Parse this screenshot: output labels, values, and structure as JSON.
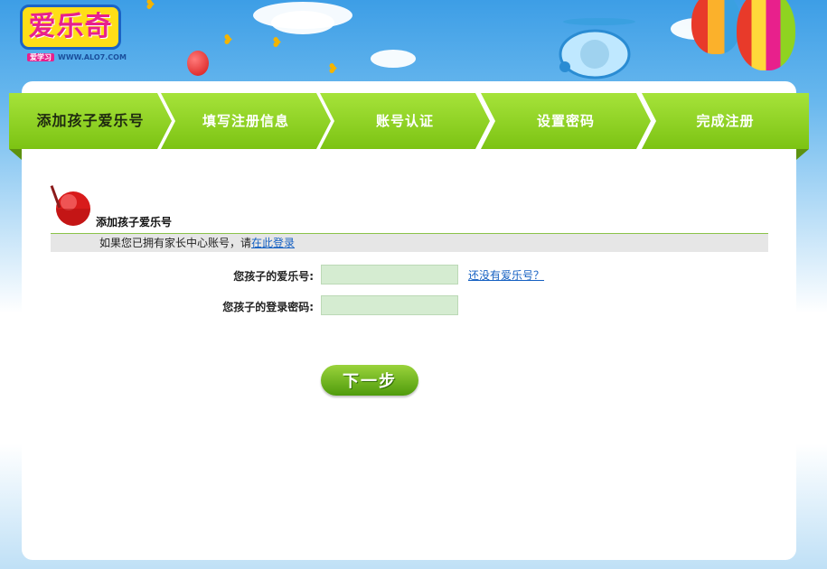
{
  "logo": {
    "title": "爱乐奇",
    "tag": "爱学习",
    "url": "WWW.ALO7.COM"
  },
  "steps": [
    {
      "label": "添加孩子爱乐号"
    },
    {
      "label": "填写注册信息"
    },
    {
      "label": "账号认证"
    },
    {
      "label": "设置密码"
    },
    {
      "label": "完成注册"
    }
  ],
  "section": {
    "title": "添加孩子爱乐号",
    "info_text": "如果您已拥有家长中心账号，请",
    "login_link": "在此登录"
  },
  "form": {
    "child_id_label": "您孩子的爱乐号:",
    "child_id_value": "",
    "no_id_link": "还没有爱乐号？",
    "child_password_label": "您孩子的登录密码:",
    "child_password_value": ""
  },
  "next_button": "下一步",
  "colors": {
    "accent_green": "#8fd320",
    "link_blue": "#1560c2",
    "input_bg": "#d5ecd1"
  }
}
